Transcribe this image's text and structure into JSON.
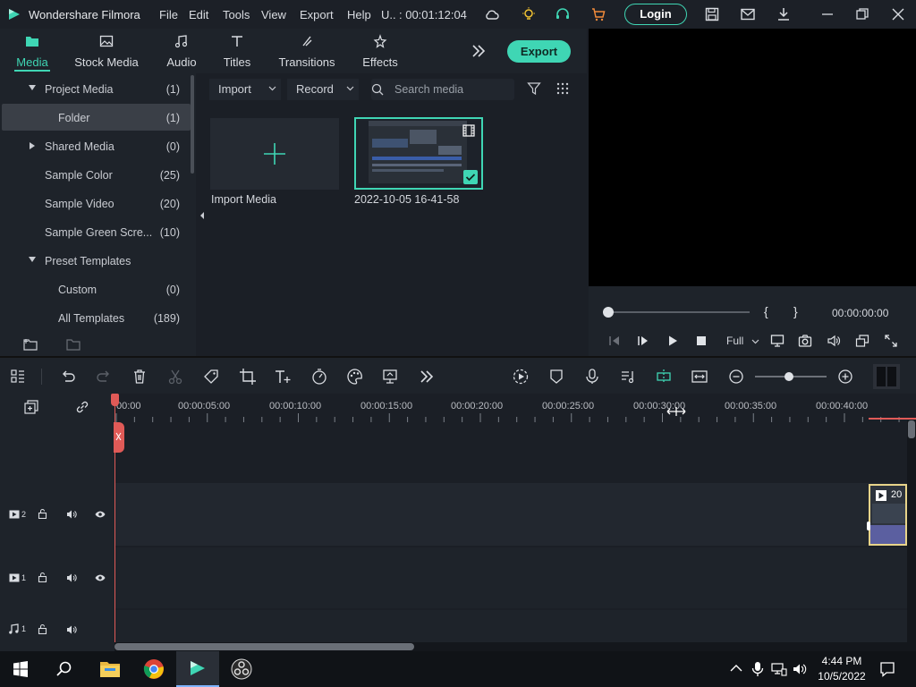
{
  "app": {
    "title": "Wondershare Filmora",
    "project_name": "U..",
    "project_duration": ": 00:01:12:04",
    "accent": "#3fd6b4"
  },
  "menu": [
    "File",
    "Edit",
    "Tools",
    "View",
    "Export",
    "Help"
  ],
  "titlebar": {
    "login_label": "Login",
    "icons": [
      "cloud-icon",
      "bulb-icon",
      "headset-icon",
      "cart-icon",
      "save-icon",
      "mail-icon",
      "download-icon",
      "minimize-icon",
      "restore-icon",
      "close-icon"
    ]
  },
  "tabs": [
    {
      "label": "Media",
      "icon": "media-icon",
      "active": true
    },
    {
      "label": "Stock Media",
      "icon": "stock-media-icon"
    },
    {
      "label": "Audio",
      "icon": "audio-icon"
    },
    {
      "label": "Titles",
      "icon": "titles-icon"
    },
    {
      "label": "Transitions",
      "icon": "transitions-icon"
    },
    {
      "label": "Effects",
      "icon": "effects-icon"
    }
  ],
  "export_label": "Export",
  "tree": [
    {
      "label": "Project Media",
      "count": "(1)",
      "arrow": "down",
      "indent": 0
    },
    {
      "label": "Folder",
      "count": "(1)",
      "indent": 1,
      "selected": true
    },
    {
      "label": "Shared Media",
      "count": "(0)",
      "arrow": "right",
      "indent": 0
    },
    {
      "label": "Sample Color",
      "count": "(25)",
      "indent": 0
    },
    {
      "label": "Sample Video",
      "count": "(20)",
      "indent": 0
    },
    {
      "label": "Sample Green Scre...",
      "count": "(10)",
      "indent": 0
    },
    {
      "label": "Preset Templates",
      "count": "",
      "arrow": "down",
      "indent": 0
    },
    {
      "label": "Custom",
      "count": "(0)",
      "indent": 1
    },
    {
      "label": "All Templates",
      "count": "(189)",
      "indent": 1
    }
  ],
  "media": {
    "import_label": "Import",
    "record_label": "Record",
    "search_placeholder": "Search media",
    "import_media_label": "Import Media",
    "clip_label": "2022-10-05 16-41-58"
  },
  "preview": {
    "timecode": "00:00:00:00",
    "zoom": "Full",
    "mark_in": "{",
    "mark_out": "}",
    "progress": 0
  },
  "ruler": [
    "00:00",
    "00:00:05:00",
    "00:00:10:00",
    "00:00:15:00",
    "00:00:20:00",
    "00:00:25:00",
    "00:00:30:00",
    "00:00:35:00",
    "00:00:40:00"
  ],
  "tracks": [
    {
      "kind": "video",
      "number": "2"
    },
    {
      "kind": "video",
      "number": "1"
    },
    {
      "kind": "audio",
      "number": "1"
    }
  ],
  "timeline_clip_label": "20",
  "taskbar": {
    "time": "4:44 PM",
    "date": "10/5/2022"
  }
}
